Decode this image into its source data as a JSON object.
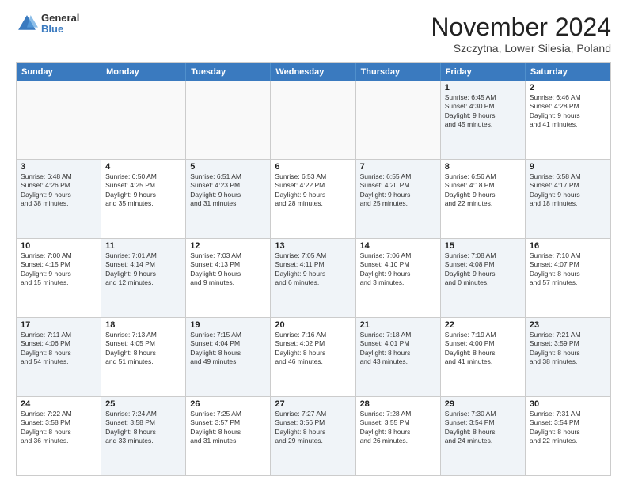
{
  "header": {
    "logo": {
      "general": "General",
      "blue": "Blue"
    },
    "title": "November 2024",
    "subtitle": "Szczytna, Lower Silesia, Poland"
  },
  "weekdays": [
    "Sunday",
    "Monday",
    "Tuesday",
    "Wednesday",
    "Thursday",
    "Friday",
    "Saturday"
  ],
  "rows": [
    [
      {
        "day": "",
        "info": "",
        "empty": true
      },
      {
        "day": "",
        "info": "",
        "empty": true
      },
      {
        "day": "",
        "info": "",
        "empty": true
      },
      {
        "day": "",
        "info": "",
        "empty": true
      },
      {
        "day": "",
        "info": "",
        "empty": true
      },
      {
        "day": "1",
        "info": "Sunrise: 6:45 AM\nSunset: 4:30 PM\nDaylight: 9 hours\nand 45 minutes.",
        "shaded": true
      },
      {
        "day": "2",
        "info": "Sunrise: 6:46 AM\nSunset: 4:28 PM\nDaylight: 9 hours\nand 41 minutes.",
        "shaded": false
      }
    ],
    [
      {
        "day": "3",
        "info": "Sunrise: 6:48 AM\nSunset: 4:26 PM\nDaylight: 9 hours\nand 38 minutes.",
        "shaded": true
      },
      {
        "day": "4",
        "info": "Sunrise: 6:50 AM\nSunset: 4:25 PM\nDaylight: 9 hours\nand 35 minutes.",
        "shaded": false
      },
      {
        "day": "5",
        "info": "Sunrise: 6:51 AM\nSunset: 4:23 PM\nDaylight: 9 hours\nand 31 minutes.",
        "shaded": true
      },
      {
        "day": "6",
        "info": "Sunrise: 6:53 AM\nSunset: 4:22 PM\nDaylight: 9 hours\nand 28 minutes.",
        "shaded": false
      },
      {
        "day": "7",
        "info": "Sunrise: 6:55 AM\nSunset: 4:20 PM\nDaylight: 9 hours\nand 25 minutes.",
        "shaded": true
      },
      {
        "day": "8",
        "info": "Sunrise: 6:56 AM\nSunset: 4:18 PM\nDaylight: 9 hours\nand 22 minutes.",
        "shaded": false
      },
      {
        "day": "9",
        "info": "Sunrise: 6:58 AM\nSunset: 4:17 PM\nDaylight: 9 hours\nand 18 minutes.",
        "shaded": true
      }
    ],
    [
      {
        "day": "10",
        "info": "Sunrise: 7:00 AM\nSunset: 4:15 PM\nDaylight: 9 hours\nand 15 minutes.",
        "shaded": false
      },
      {
        "day": "11",
        "info": "Sunrise: 7:01 AM\nSunset: 4:14 PM\nDaylight: 9 hours\nand 12 minutes.",
        "shaded": true
      },
      {
        "day": "12",
        "info": "Sunrise: 7:03 AM\nSunset: 4:13 PM\nDaylight: 9 hours\nand 9 minutes.",
        "shaded": false
      },
      {
        "day": "13",
        "info": "Sunrise: 7:05 AM\nSunset: 4:11 PM\nDaylight: 9 hours\nand 6 minutes.",
        "shaded": true
      },
      {
        "day": "14",
        "info": "Sunrise: 7:06 AM\nSunset: 4:10 PM\nDaylight: 9 hours\nand 3 minutes.",
        "shaded": false
      },
      {
        "day": "15",
        "info": "Sunrise: 7:08 AM\nSunset: 4:08 PM\nDaylight: 9 hours\nand 0 minutes.",
        "shaded": true
      },
      {
        "day": "16",
        "info": "Sunrise: 7:10 AM\nSunset: 4:07 PM\nDaylight: 8 hours\nand 57 minutes.",
        "shaded": false
      }
    ],
    [
      {
        "day": "17",
        "info": "Sunrise: 7:11 AM\nSunset: 4:06 PM\nDaylight: 8 hours\nand 54 minutes.",
        "shaded": true
      },
      {
        "day": "18",
        "info": "Sunrise: 7:13 AM\nSunset: 4:05 PM\nDaylight: 8 hours\nand 51 minutes.",
        "shaded": false
      },
      {
        "day": "19",
        "info": "Sunrise: 7:15 AM\nSunset: 4:04 PM\nDaylight: 8 hours\nand 49 minutes.",
        "shaded": true
      },
      {
        "day": "20",
        "info": "Sunrise: 7:16 AM\nSunset: 4:02 PM\nDaylight: 8 hours\nand 46 minutes.",
        "shaded": false
      },
      {
        "day": "21",
        "info": "Sunrise: 7:18 AM\nSunset: 4:01 PM\nDaylight: 8 hours\nand 43 minutes.",
        "shaded": true
      },
      {
        "day": "22",
        "info": "Sunrise: 7:19 AM\nSunset: 4:00 PM\nDaylight: 8 hours\nand 41 minutes.",
        "shaded": false
      },
      {
        "day": "23",
        "info": "Sunrise: 7:21 AM\nSunset: 3:59 PM\nDaylight: 8 hours\nand 38 minutes.",
        "shaded": true
      }
    ],
    [
      {
        "day": "24",
        "info": "Sunrise: 7:22 AM\nSunset: 3:58 PM\nDaylight: 8 hours\nand 36 minutes.",
        "shaded": false
      },
      {
        "day": "25",
        "info": "Sunrise: 7:24 AM\nSunset: 3:58 PM\nDaylight: 8 hours\nand 33 minutes.",
        "shaded": true
      },
      {
        "day": "26",
        "info": "Sunrise: 7:25 AM\nSunset: 3:57 PM\nDaylight: 8 hours\nand 31 minutes.",
        "shaded": false
      },
      {
        "day": "27",
        "info": "Sunrise: 7:27 AM\nSunset: 3:56 PM\nDaylight: 8 hours\nand 29 minutes.",
        "shaded": true
      },
      {
        "day": "28",
        "info": "Sunrise: 7:28 AM\nSunset: 3:55 PM\nDaylight: 8 hours\nand 26 minutes.",
        "shaded": false
      },
      {
        "day": "29",
        "info": "Sunrise: 7:30 AM\nSunset: 3:54 PM\nDaylight: 8 hours\nand 24 minutes.",
        "shaded": true
      },
      {
        "day": "30",
        "info": "Sunrise: 7:31 AM\nSunset: 3:54 PM\nDaylight: 8 hours\nand 22 minutes.",
        "shaded": false
      }
    ]
  ]
}
